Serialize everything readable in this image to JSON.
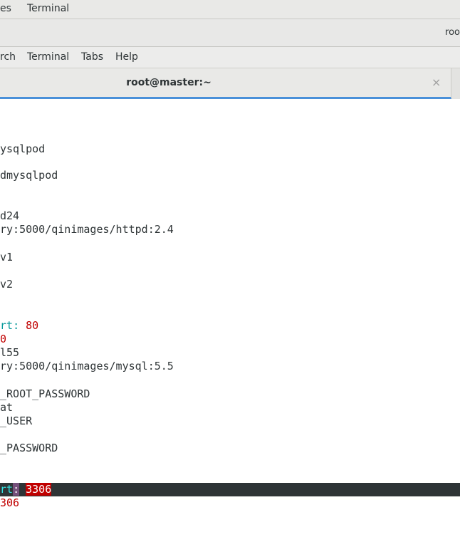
{
  "top_bar": {
    "menu_1": "es",
    "menu_2": "Terminal"
  },
  "window": {
    "title": "roo"
  },
  "menubar": {
    "items": [
      "rch",
      "Terminal",
      "Tabs",
      "Help"
    ]
  },
  "tab": {
    "title": "root@master:~",
    "close_glyph": "×"
  },
  "terminal": {
    "lines": {
      "l1": "ysqlpod",
      "l2": "dmysqlpod",
      "l3": "d24",
      "l4": "ry:5000/qinimages/httpd:2.4",
      "l5": "v1",
      "l6": "v2",
      "l7_key": "rt",
      "l7_sep": ": ",
      "l7_val": "80",
      "l8": "0",
      "l9": "l55",
      "l10": "ry:5000/qinimages/mysql:5.5",
      "l11": "_ROOT_PASSWORD",
      "l12": "at",
      "l13": "_USER",
      "l14": "_PASSWORD",
      "l15_key": "rt",
      "l15_sep": ":",
      "l15_space": " ",
      "l15_val": "3306",
      "l16": "306"
    },
    "colors": {
      "key": "#06989a",
      "value": "#c00000",
      "cursorline": "#2e3436"
    }
  }
}
